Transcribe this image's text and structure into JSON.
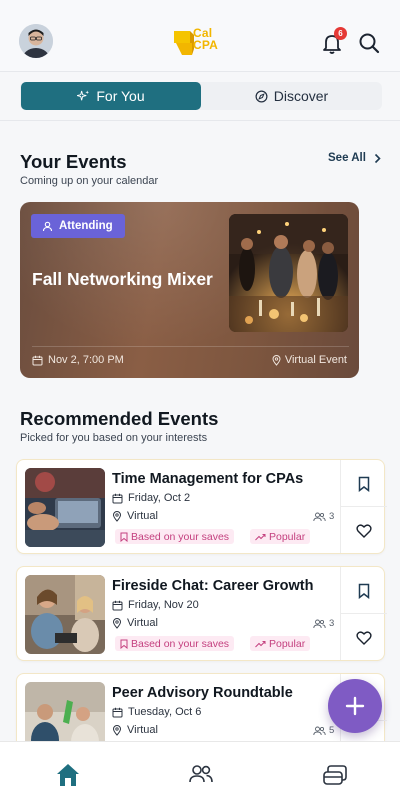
{
  "header": {
    "logo_text_line1": "Cal",
    "logo_text_line2": "CPA",
    "notification_count": "6"
  },
  "tabs": [
    {
      "label": "For You",
      "active": true
    },
    {
      "label": "Discover",
      "active": false
    }
  ],
  "your_events": {
    "title": "Your Events",
    "subtitle": "Coming up on your calendar",
    "see_all_label": "See All",
    "featured": {
      "badge": "Attending",
      "title": "Fall Networking Mixer",
      "date": "Nov 2, 7:00 PM",
      "location": "Virtual Event"
    }
  },
  "recommended": {
    "title": "Recommended Events",
    "subtitle": "Picked for you based on your interests",
    "items": [
      {
        "title": "Time Management for CPAs",
        "date": "Friday, Oct 2",
        "mode": "Virtual",
        "attendees": "3",
        "tag1": "Based on your saves",
        "tag2": "Popular"
      },
      {
        "title": "Fireside Chat: Career Growth",
        "date": "Friday, Nov 20",
        "mode": "Virtual",
        "attendees": "3",
        "tag1": "Based on your saves",
        "tag2": "Popular"
      },
      {
        "title": "Peer Advisory Roundtable",
        "date": "Tuesday, Oct 6",
        "mode": "Virtual",
        "attendees": "5"
      }
    ]
  },
  "colors": {
    "accent": "#1f6f80",
    "badge": "#6a63d8",
    "fab": "#7f5bc4",
    "tag_text": "#c4407f",
    "tag_bg": "#fdeaf3",
    "logo": "#f2b600"
  },
  "icons": [
    "avatar",
    "calcpa-logo",
    "bell-icon",
    "search-icon",
    "sparkle-icon",
    "compass-icon",
    "chevron-right-icon",
    "person-icon",
    "calendar-icon",
    "location-pin-icon",
    "users-icon",
    "bookmark-icon",
    "heart-icon",
    "trending-icon",
    "plus-icon",
    "home-icon",
    "community-icon",
    "stack-icon"
  ]
}
